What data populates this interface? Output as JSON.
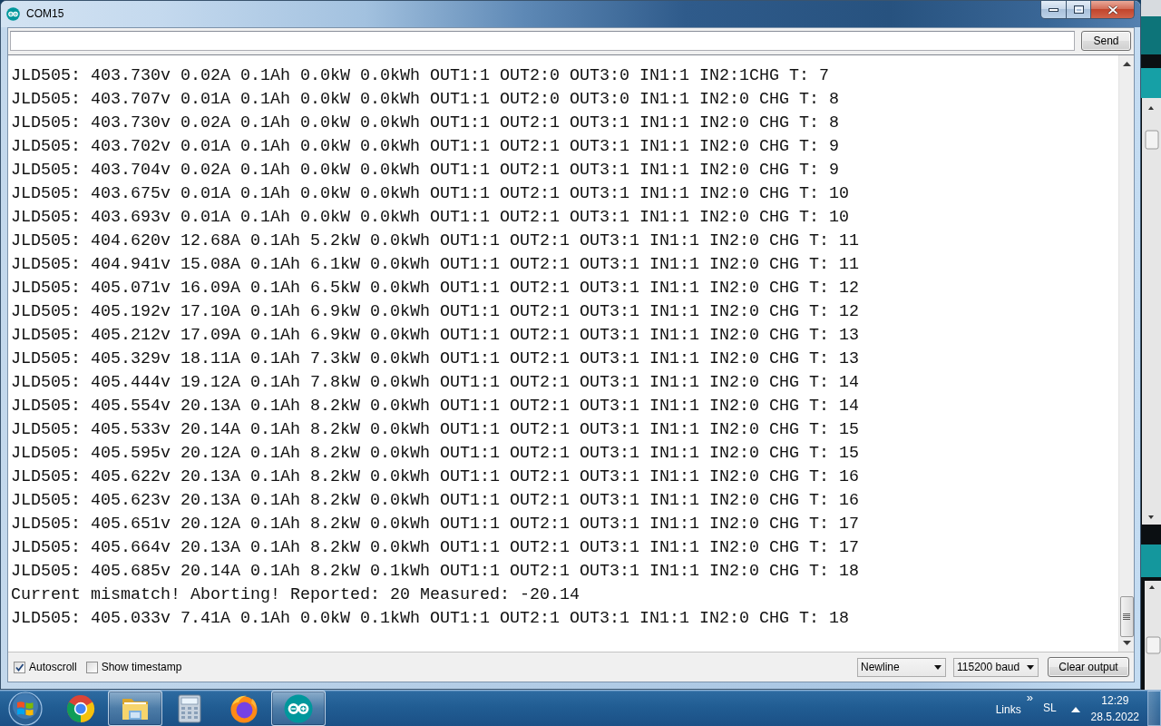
{
  "window": {
    "title": "COM15"
  },
  "send_button": "Send",
  "output_lines": [
    "JLD505: 403.730v 0.02A 0.1Ah 0.0kW 0.0kWh OUT1:1 OUT2:0 OUT3:0 IN1:1 IN2:1CHG T: 7",
    "JLD505: 403.707v 0.01A 0.1Ah 0.0kW 0.0kWh OUT1:1 OUT2:0 OUT3:0 IN1:1 IN2:0 CHG T: 8",
    "JLD505: 403.730v 0.02A 0.1Ah 0.0kW 0.0kWh OUT1:1 OUT2:1 OUT3:1 IN1:1 IN2:0 CHG T: 8",
    "JLD505: 403.702v 0.01A 0.1Ah 0.0kW 0.0kWh OUT1:1 OUT2:1 OUT3:1 IN1:1 IN2:0 CHG T: 9",
    "JLD505: 403.704v 0.02A 0.1Ah 0.0kW 0.0kWh OUT1:1 OUT2:1 OUT3:1 IN1:1 IN2:0 CHG T: 9",
    "JLD505: 403.675v 0.01A 0.1Ah 0.0kW 0.0kWh OUT1:1 OUT2:1 OUT3:1 IN1:1 IN2:0 CHG T: 10",
    "JLD505: 403.693v 0.01A 0.1Ah 0.0kW 0.0kWh OUT1:1 OUT2:1 OUT3:1 IN1:1 IN2:0 CHG T: 10",
    "JLD505: 404.620v 12.68A 0.1Ah 5.2kW 0.0kWh OUT1:1 OUT2:1 OUT3:1 IN1:1 IN2:0 CHG T: 11",
    "JLD505: 404.941v 15.08A 0.1Ah 6.1kW 0.0kWh OUT1:1 OUT2:1 OUT3:1 IN1:1 IN2:0 CHG T: 11",
    "JLD505: 405.071v 16.09A 0.1Ah 6.5kW 0.0kWh OUT1:1 OUT2:1 OUT3:1 IN1:1 IN2:0 CHG T: 12",
    "JLD505: 405.192v 17.10A 0.1Ah 6.9kW 0.0kWh OUT1:1 OUT2:1 OUT3:1 IN1:1 IN2:0 CHG T: 12",
    "JLD505: 405.212v 17.09A 0.1Ah 6.9kW 0.0kWh OUT1:1 OUT2:1 OUT3:1 IN1:1 IN2:0 CHG T: 13",
    "JLD505: 405.329v 18.11A 0.1Ah 7.3kW 0.0kWh OUT1:1 OUT2:1 OUT3:1 IN1:1 IN2:0 CHG T: 13",
    "JLD505: 405.444v 19.12A 0.1Ah 7.8kW 0.0kWh OUT1:1 OUT2:1 OUT3:1 IN1:1 IN2:0 CHG T: 14",
    "JLD505: 405.554v 20.13A 0.1Ah 8.2kW 0.0kWh OUT1:1 OUT2:1 OUT3:1 IN1:1 IN2:0 CHG T: 14",
    "JLD505: 405.533v 20.14A 0.1Ah 8.2kW 0.0kWh OUT1:1 OUT2:1 OUT3:1 IN1:1 IN2:0 CHG T: 15",
    "JLD505: 405.595v 20.12A 0.1Ah 8.2kW 0.0kWh OUT1:1 OUT2:1 OUT3:1 IN1:1 IN2:0 CHG T: 15",
    "JLD505: 405.622v 20.13A 0.1Ah 8.2kW 0.0kWh OUT1:1 OUT2:1 OUT3:1 IN1:1 IN2:0 CHG T: 16",
    "JLD505: 405.623v 20.13A 0.1Ah 8.2kW 0.0kWh OUT1:1 OUT2:1 OUT3:1 IN1:1 IN2:0 CHG T: 16",
    "JLD505: 405.651v 20.12A 0.1Ah 8.2kW 0.0kWh OUT1:1 OUT2:1 OUT3:1 IN1:1 IN2:0 CHG T: 17",
    "JLD505: 405.664v 20.13A 0.1Ah 8.2kW 0.0kWh OUT1:1 OUT2:1 OUT3:1 IN1:1 IN2:0 CHG T: 17",
    "JLD505: 405.685v 20.14A 0.1Ah 8.2kW 0.1kWh OUT1:1 OUT2:1 OUT3:1 IN1:1 IN2:0 CHG T: 18",
    "Current mismatch! Aborting! Reported: 20 Measured: -20.14",
    "JLD505: 405.033v 7.41A 0.1Ah 0.0kW 0.1kWh OUT1:1 OUT2:1 OUT3:1 IN1:1 IN2:0 CHG T: 18"
  ],
  "options": [
    {
      "label": "Autoscroll",
      "checked": true
    },
    {
      "label": "Show timestamp",
      "checked": false
    }
  ],
  "line_ending": {
    "value": "Newline"
  },
  "baud_rate": {
    "value": "115200 baud"
  },
  "clear_button": "Clear output",
  "taskbar": {
    "apps": [
      {
        "kind": "chrome",
        "running": false
      },
      {
        "kind": "explorer",
        "running": true
      },
      {
        "kind": "calculator",
        "running": false
      },
      {
        "kind": "firefox",
        "running": false
      },
      {
        "kind": "arduino",
        "running": true
      }
    ],
    "toolbar_label": "Links",
    "toolbar_overflow": "»",
    "language": "SL",
    "time": "12:29",
    "date": "28.5.2022"
  }
}
